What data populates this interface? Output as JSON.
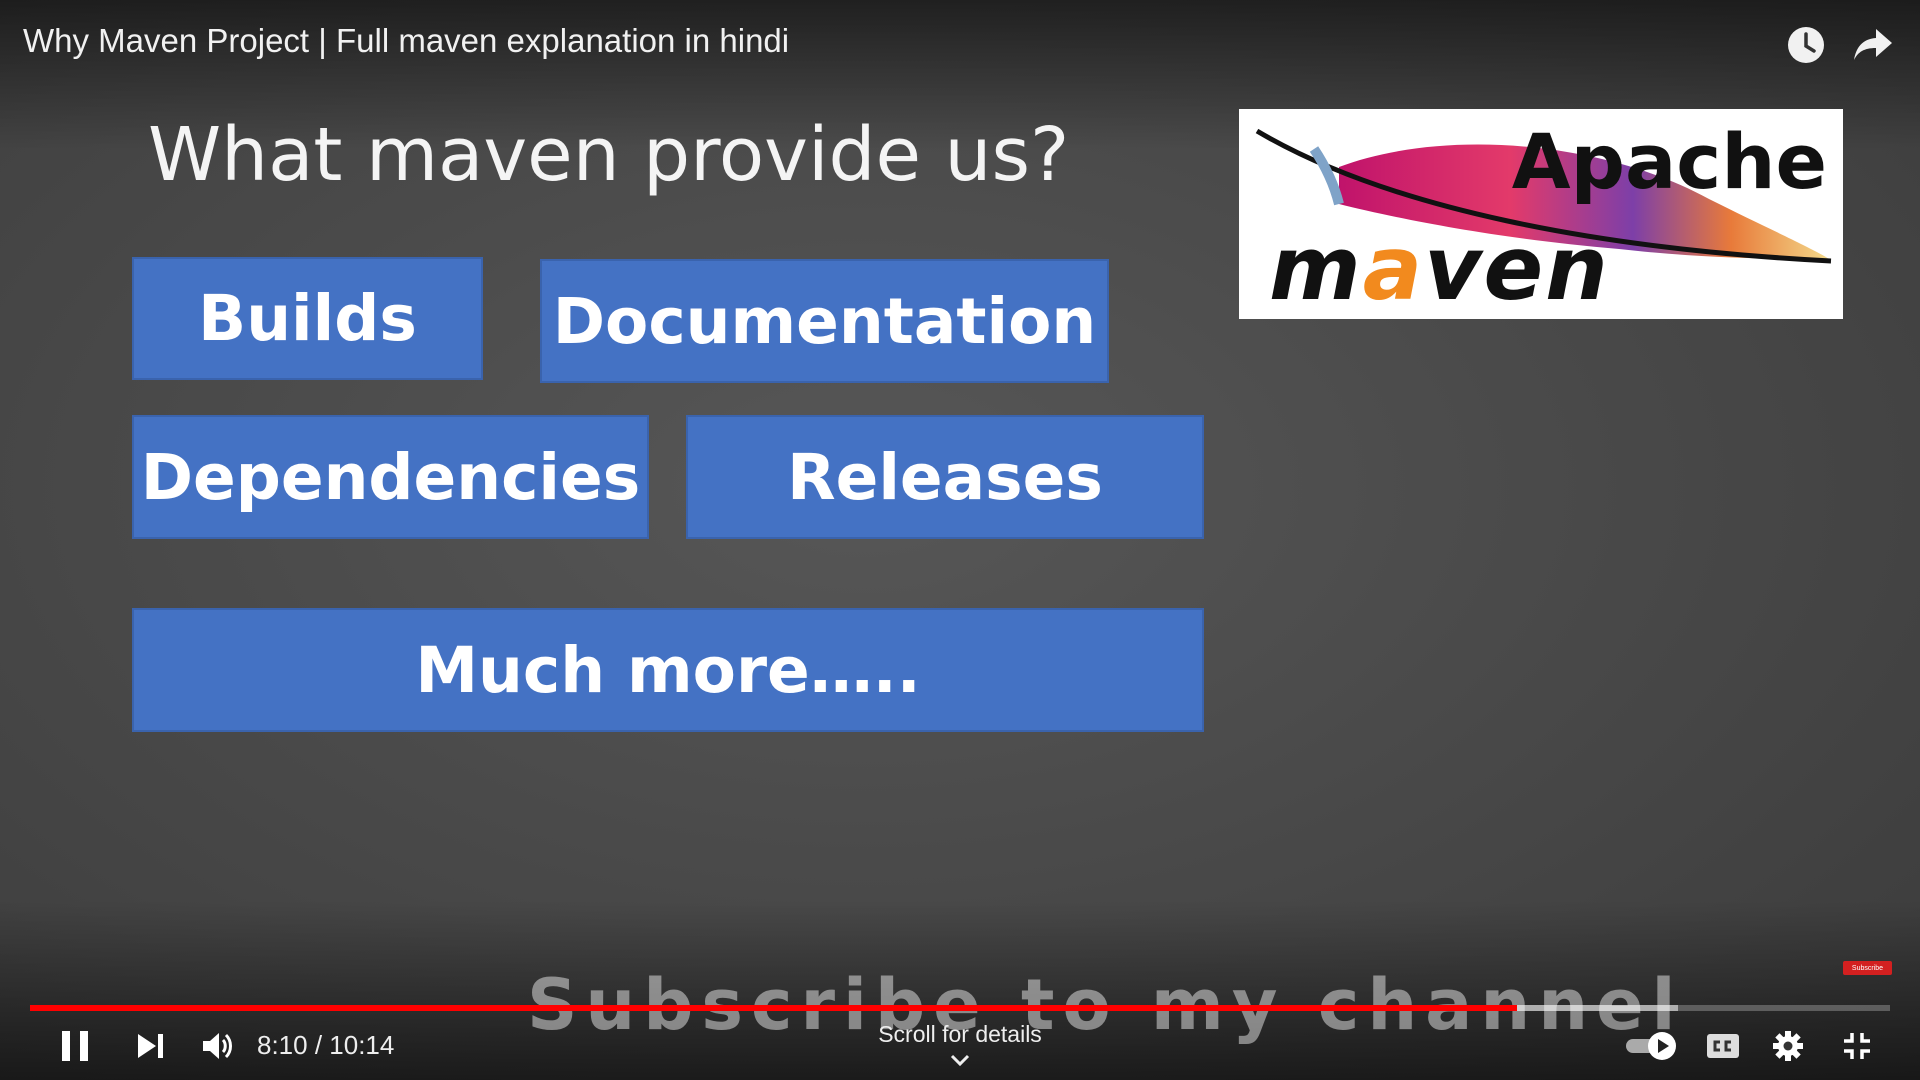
{
  "video": {
    "title": "Why Maven Project | Full maven explanation in hindi"
  },
  "top_actions": {
    "watch_later_icon": "clock-icon",
    "share_icon": "share-arrow-icon"
  },
  "slide": {
    "heading": "What maven provide us?",
    "boxes": {
      "builds": "Builds",
      "documentation": "Documentation",
      "dependencies": "Dependencies",
      "releases": "Releases",
      "much_more": "Much more….."
    },
    "box_color": "#4472c4",
    "logo": {
      "apache": "Apache",
      "maven_m": "m",
      "maven_a": "a",
      "maven_rest": "ven"
    }
  },
  "overlay": {
    "watermark": "Subscribe to my channel",
    "badge": "Subscribe"
  },
  "controls": {
    "current_time": "8:10",
    "duration": "10:14",
    "time_display": "8:10 / 10:14",
    "played_fraction": 0.7997,
    "buffered_fraction": 0.886,
    "scroll_hint": "Scroll for details",
    "progress_color": "#ff0000",
    "icons": {
      "pause": "pause-icon",
      "next": "next-icon",
      "volume": "volume-icon",
      "autoplay": "autoplay-toggle-icon",
      "cc": "closed-captions-icon",
      "settings": "gear-icon",
      "fullscreen": "exit-fullscreen-icon"
    }
  }
}
